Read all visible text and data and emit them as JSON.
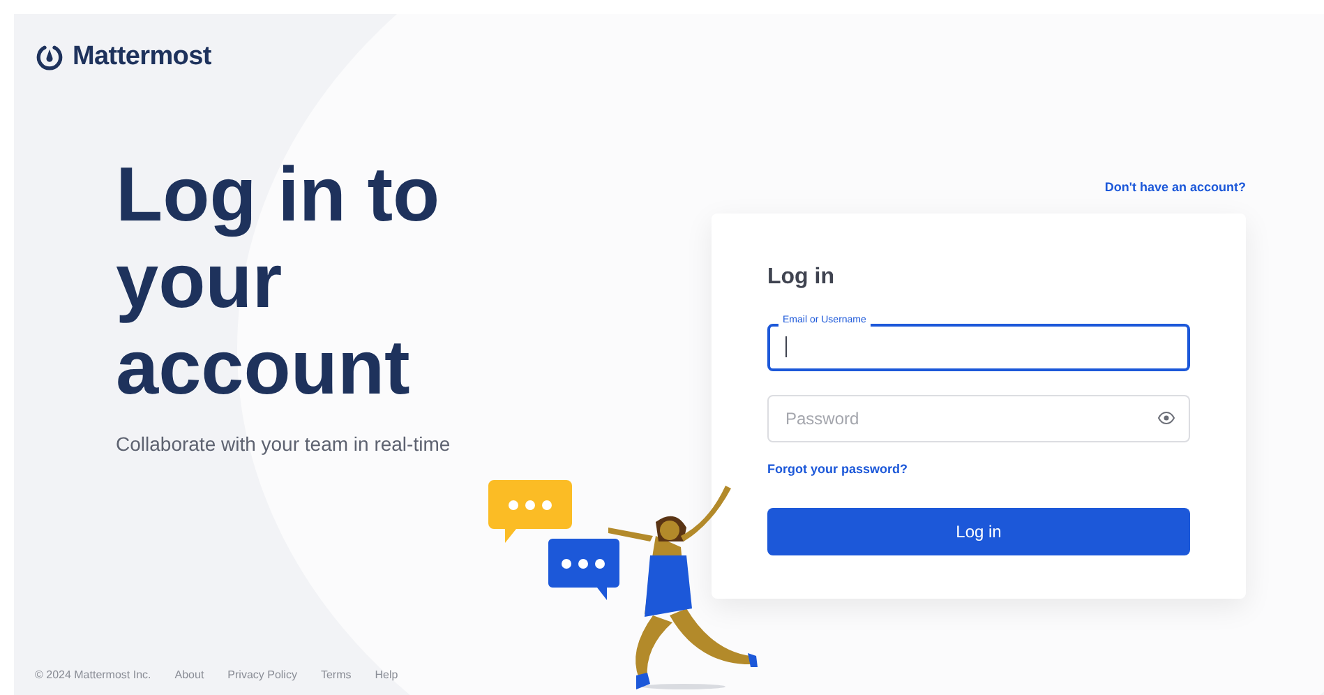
{
  "brand": {
    "name": "Mattermost"
  },
  "hero": {
    "heading": "Log in to your account",
    "subtitle": "Collaborate with your team in real-time"
  },
  "signup_link": "Don't have an account?",
  "card": {
    "title": "Log in",
    "fields": [
      {
        "kind": "text",
        "label": "Email or Username",
        "focused": true
      },
      {
        "kind": "password",
        "placeholder": "Password",
        "focused": false
      }
    ],
    "forgot_link": "Forgot your password?",
    "submit": "Log in"
  },
  "footer": {
    "copyright": "© 2024 Mattermost Inc.",
    "links": [
      "About",
      "Privacy Policy",
      "Terms",
      "Help"
    ]
  }
}
